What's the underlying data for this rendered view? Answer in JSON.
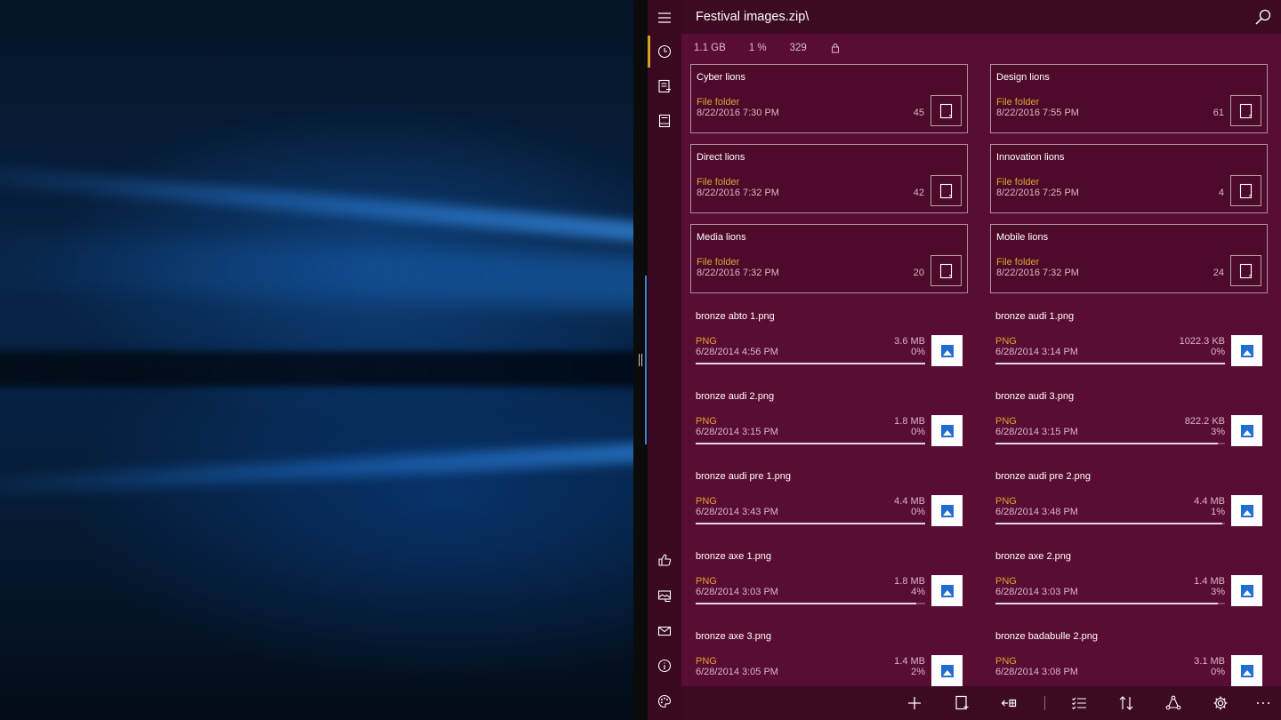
{
  "window": {
    "title": "Festival images.zip\\"
  },
  "info": {
    "size": "1.1 GB",
    "ratio": "1 %",
    "count": "329"
  },
  "folders": [
    {
      "name": "Cyber lions",
      "type": "File folder",
      "date": "8/22/2016 7:30 PM",
      "count": "45"
    },
    {
      "name": "Design lions",
      "type": "File folder",
      "date": "8/22/2016 7:55 PM",
      "count": "61"
    },
    {
      "name": "Direct lions",
      "type": "File folder",
      "date": "8/22/2016 7:32 PM",
      "count": "42"
    },
    {
      "name": "Innovation lions",
      "type": "File folder",
      "date": "8/22/2016 7:25 PM",
      "count": "4"
    },
    {
      "name": "Media lions",
      "type": "File folder",
      "date": "8/22/2016 7:32 PM",
      "count": "20"
    },
    {
      "name": "Mobile lions",
      "type": "File folder",
      "date": "8/22/2016 7:32 PM",
      "count": "24"
    }
  ],
  "files": [
    {
      "name": "bronze abto 1.png",
      "type": "PNG",
      "date": "6/28/2014 4:56 PM",
      "size": "3.6 MB",
      "pct": "0%"
    },
    {
      "name": "bronze audi 1.png",
      "type": "PNG",
      "date": "6/28/2014 3:14 PM",
      "size": "1022.3 KB",
      "pct": "0%"
    },
    {
      "name": "bronze audi 2.png",
      "type": "PNG",
      "date": "6/28/2014 3:15 PM",
      "size": "1.8 MB",
      "pct": "0%"
    },
    {
      "name": "bronze audi 3.png",
      "type": "PNG",
      "date": "6/28/2014 3:15 PM",
      "size": "822.2 KB",
      "pct": "3%"
    },
    {
      "name": "bronze audi pre 1.png",
      "type": "PNG",
      "date": "6/28/2014 3:43 PM",
      "size": "4.4 MB",
      "pct": "0%"
    },
    {
      "name": "bronze audi pre 2.png",
      "type": "PNG",
      "date": "6/28/2014 3:48 PM",
      "size": "4.4 MB",
      "pct": "1%"
    },
    {
      "name": "bronze axe 1.png",
      "type": "PNG",
      "date": "6/28/2014 3:03 PM",
      "size": "1.8 MB",
      "pct": "4%"
    },
    {
      "name": "bronze axe 2.png",
      "type": "PNG",
      "date": "6/28/2014 3:03 PM",
      "size": "1.4 MB",
      "pct": "3%"
    },
    {
      "name": "bronze axe 3.png",
      "type": "PNG",
      "date": "6/28/2014 3:05 PM",
      "size": "1.4 MB",
      "pct": "2%"
    },
    {
      "name": "bronze badabulle 2.png",
      "type": "PNG",
      "date": "6/28/2014 3:08 PM",
      "size": "3.1 MB",
      "pct": "0%"
    }
  ],
  "colors": {
    "app_background": "#5a0d33",
    "header_background": "#3c0a22",
    "sidebar_background": "#3a0820",
    "type_text": "#d9a531",
    "active_indicator": "#d6a020",
    "splitter_accent": "#3a7fc8"
  },
  "icons": {
    "sidebar_top": [
      "hamburger-menu-icon",
      "recent-clock-icon",
      "archive-icon",
      "book-icon"
    ],
    "sidebar_bottom": [
      "like-icon",
      "photos-icon",
      "mail-icon",
      "info-icon",
      "palette-icon"
    ],
    "header": [
      "search-icon",
      "lock-icon"
    ],
    "bottom_bar": [
      "add-icon",
      "new-folder-icon",
      "extract-icon",
      "select-list-icon",
      "sort-icon",
      "share-icon",
      "settings-icon",
      "more-icon"
    ]
  }
}
